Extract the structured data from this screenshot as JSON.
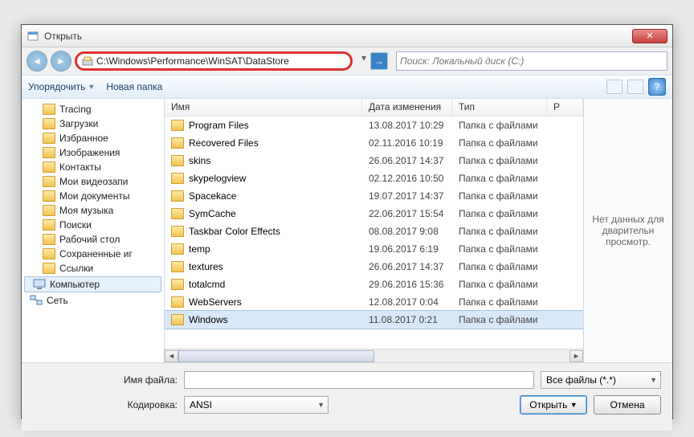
{
  "window": {
    "title": "Открыть"
  },
  "address": {
    "path": "C:\\Windows\\Performance\\WinSAT\\DataStore",
    "search_placeholder": "Поиск: Локальный диск (C:)"
  },
  "toolbar": {
    "organize": "Упорядочить",
    "new_folder": "Новая папка"
  },
  "tree": {
    "items": [
      {
        "label": "Tracing",
        "icon": "folder"
      },
      {
        "label": "Загрузки",
        "icon": "folder"
      },
      {
        "label": "Избранное",
        "icon": "favorites"
      },
      {
        "label": "Изображения",
        "icon": "pictures"
      },
      {
        "label": "Контакты",
        "icon": "contacts"
      },
      {
        "label": "Мои видеозапи",
        "icon": "video"
      },
      {
        "label": "Мои документы",
        "icon": "documents"
      },
      {
        "label": "Моя музыка",
        "icon": "music"
      },
      {
        "label": "Поиски",
        "icon": "search"
      },
      {
        "label": "Рабочий стол",
        "icon": "desktop"
      },
      {
        "label": "Сохраненные иг",
        "icon": "games"
      },
      {
        "label": "Ссылки",
        "icon": "links"
      }
    ],
    "computer": "Компьютер",
    "network": "Сеть"
  },
  "columns": {
    "name": "Имя",
    "date": "Дата изменения",
    "type": "Тип",
    "size": "Р"
  },
  "files": [
    {
      "name": "Program Files",
      "date": "13.08.2017 10:29",
      "type": "Папка с файлами"
    },
    {
      "name": "Recovered Files",
      "date": "02.11.2016 10:19",
      "type": "Папка с файлами"
    },
    {
      "name": "skins",
      "date": "26.06.2017 14:37",
      "type": "Папка с файлами"
    },
    {
      "name": "skypelogview",
      "date": "02.12.2016 10:50",
      "type": "Папка с файлами"
    },
    {
      "name": "Spacekace",
      "date": "19.07.2017 14:37",
      "type": "Папка с файлами"
    },
    {
      "name": "SymCache",
      "date": "22.06.2017 15:54",
      "type": "Папка с файлами"
    },
    {
      "name": "Taskbar Color Effects",
      "date": "08.08.2017 9:08",
      "type": "Папка с файлами"
    },
    {
      "name": "temp",
      "date": "19.06.2017 6:19",
      "type": "Папка с файлами"
    },
    {
      "name": "textures",
      "date": "26.06.2017 14:37",
      "type": "Папка с файлами"
    },
    {
      "name": "totalcmd",
      "date": "29.06.2016 15:36",
      "type": "Папка с файлами"
    },
    {
      "name": "WebServers",
      "date": "12.08.2017 0:04",
      "type": "Папка с файлами"
    },
    {
      "name": "Windows",
      "date": "11.08.2017 0:21",
      "type": "Папка с файлами",
      "selected": true
    }
  ],
  "preview": {
    "text": "Нет данных для дварительн просмотр."
  },
  "bottom": {
    "filename_label": "Имя файла:",
    "filename_value": "",
    "encoding_label": "Кодировка:",
    "encoding_value": "ANSI",
    "filter_value": "Все файлы (*.*)",
    "open": "Открыть",
    "cancel": "Отмена"
  }
}
